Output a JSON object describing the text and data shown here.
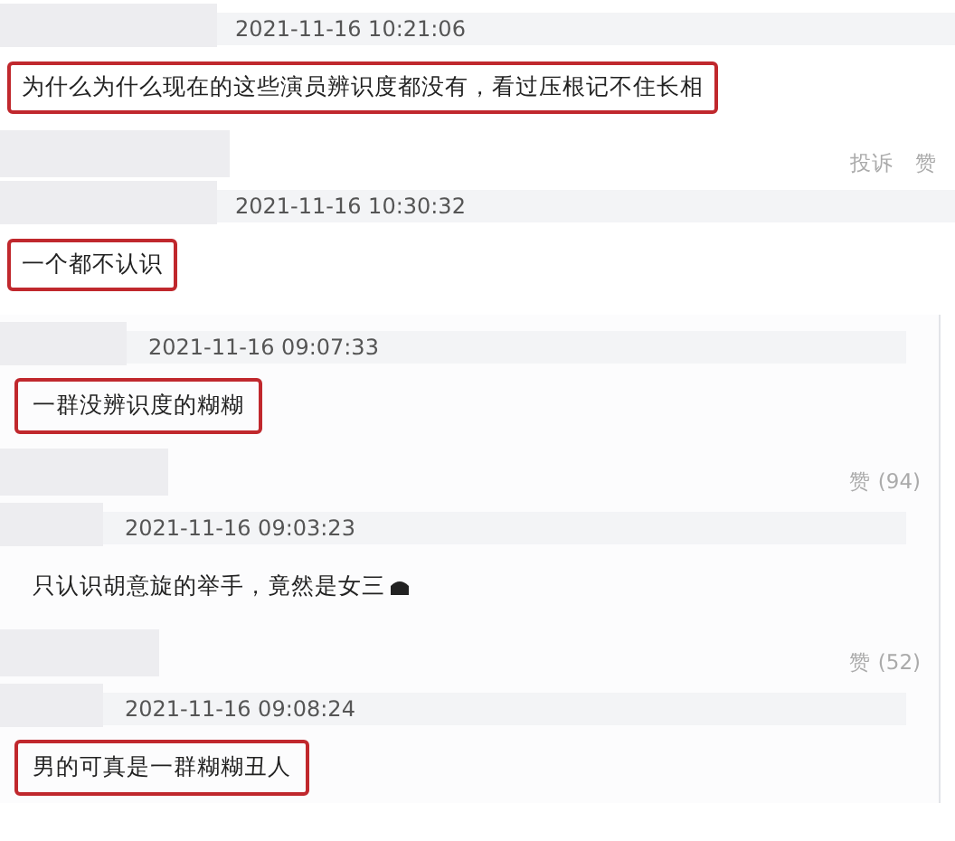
{
  "comments": [
    {
      "time": "2021-11-16 10:21:06",
      "text": "为什么为什么现在的这些演员辨识度都没有，看过压根记不住长相",
      "highlighted": true,
      "emoji": false,
      "actions": [
        "投诉",
        "赞"
      ]
    },
    {
      "time": "2021-11-16 10:30:32",
      "text": "一个都不认识",
      "highlighted": true,
      "emoji": false
    }
  ],
  "replies": [
    {
      "time": "2021-11-16 09:07:33",
      "text": "一群没辨识度的糊糊",
      "highlighted": true,
      "emoji": false,
      "actions": [
        "赞 (94)"
      ]
    },
    {
      "time": "2021-11-16 09:03:23",
      "text": "只认识胡意旋的举手，竟然是女三",
      "highlighted": false,
      "emoji": true,
      "actions": [
        "赞 (52)"
      ]
    },
    {
      "time": "2021-11-16 09:08:24",
      "text": "男的可真是一群糊糊丑人",
      "highlighted": true,
      "emoji": false
    }
  ]
}
